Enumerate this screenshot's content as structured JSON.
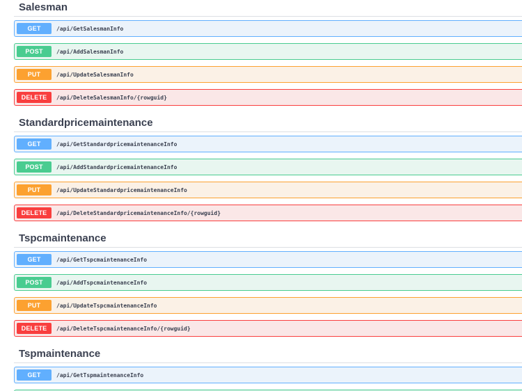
{
  "sections": [
    {
      "title": "Salesman",
      "operations": [
        {
          "method": "GET",
          "path": "/api/GetSalesmanInfo"
        },
        {
          "method": "POST",
          "path": "/api/AddSalesmanInfo"
        },
        {
          "method": "PUT",
          "path": "/api/UpdateSalesmanInfo"
        },
        {
          "method": "DELETE",
          "path": "/api/DeleteSalesmanInfo/{rowguid}"
        }
      ]
    },
    {
      "title": "Standardpricemaintenance",
      "operations": [
        {
          "method": "GET",
          "path": "/api/GetStandardpricemaintenanceInfo"
        },
        {
          "method": "POST",
          "path": "/api/AddStandardpricemaintenanceInfo"
        },
        {
          "method": "PUT",
          "path": "/api/UpdateStandardpricemaintenanceInfo"
        },
        {
          "method": "DELETE",
          "path": "/api/DeleteStandardpricemaintenanceInfo/{rowguid}"
        }
      ]
    },
    {
      "title": "Tspcmaintenance",
      "operations": [
        {
          "method": "GET",
          "path": "/api/GetTspcmaintenanceInfo"
        },
        {
          "method": "POST",
          "path": "/api/AddTspcmaintenanceInfo"
        },
        {
          "method": "PUT",
          "path": "/api/UpdateTspcmaintenanceInfo"
        },
        {
          "method": "DELETE",
          "path": "/api/DeleteTspcmaintenanceInfo/{rowguid}"
        }
      ]
    },
    {
      "title": "Tspmaintenance",
      "operations": [
        {
          "method": "GET",
          "path": "/api/GetTspmaintenanceInfo"
        }
      ]
    }
  ],
  "method_colors": {
    "GET": "#61affe",
    "POST": "#49cc90",
    "PUT": "#fca130",
    "DELETE": "#f93e3e"
  }
}
